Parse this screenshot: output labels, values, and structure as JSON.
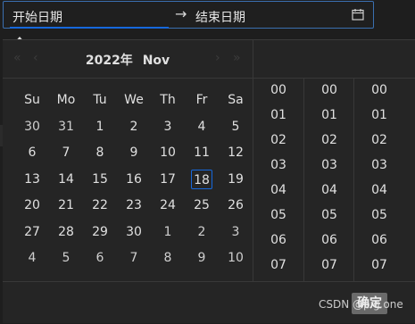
{
  "range_input": {
    "start_placeholder": "开始日期",
    "separator": "→",
    "end_placeholder": "结束日期",
    "icon": "calendar-icon"
  },
  "header": {
    "year": "2022年",
    "month": "Nov"
  },
  "weekdays": [
    "Su",
    "Mo",
    "Tu",
    "We",
    "Th",
    "Fr",
    "Sa"
  ],
  "weeks": [
    [
      {
        "d": "30",
        "m": "prev"
      },
      {
        "d": "31",
        "m": "prev"
      },
      {
        "d": "1"
      },
      {
        "d": "2"
      },
      {
        "d": "3"
      },
      {
        "d": "4"
      },
      {
        "d": "5"
      }
    ],
    [
      {
        "d": "6"
      },
      {
        "d": "7"
      },
      {
        "d": "8"
      },
      {
        "d": "9"
      },
      {
        "d": "10"
      },
      {
        "d": "11"
      },
      {
        "d": "12"
      }
    ],
    [
      {
        "d": "13"
      },
      {
        "d": "14"
      },
      {
        "d": "15"
      },
      {
        "d": "16"
      },
      {
        "d": "17"
      },
      {
        "d": "18",
        "today": true
      },
      {
        "d": "19"
      }
    ],
    [
      {
        "d": "20"
      },
      {
        "d": "21"
      },
      {
        "d": "22"
      },
      {
        "d": "23"
      },
      {
        "d": "24"
      },
      {
        "d": "25"
      },
      {
        "d": "26"
      }
    ],
    [
      {
        "d": "27"
      },
      {
        "d": "28"
      },
      {
        "d": "29"
      },
      {
        "d": "30"
      },
      {
        "d": "1",
        "m": "next"
      },
      {
        "d": "2",
        "m": "next"
      },
      {
        "d": "3",
        "m": "next"
      }
    ],
    [
      {
        "d": "4",
        "m": "next"
      },
      {
        "d": "5",
        "m": "next"
      },
      {
        "d": "6",
        "m": "next"
      },
      {
        "d": "7",
        "m": "next"
      },
      {
        "d": "8",
        "m": "next"
      },
      {
        "d": "9",
        "m": "next"
      },
      {
        "d": "10",
        "m": "next"
      }
    ]
  ],
  "time_columns": [
    [
      "00",
      "01",
      "02",
      "03",
      "04",
      "05",
      "06",
      "07"
    ],
    [
      "00",
      "01",
      "02",
      "03",
      "04",
      "05",
      "06",
      "07"
    ],
    [
      "00",
      "01",
      "02",
      "03",
      "04",
      "05",
      "06",
      "07"
    ]
  ],
  "footer": {
    "ok_label": "确定"
  },
  "watermark": "CSDN @pig one",
  "colors": {
    "accent": "#1668dc",
    "panel": "#252525",
    "background": "#1e1e1e"
  }
}
